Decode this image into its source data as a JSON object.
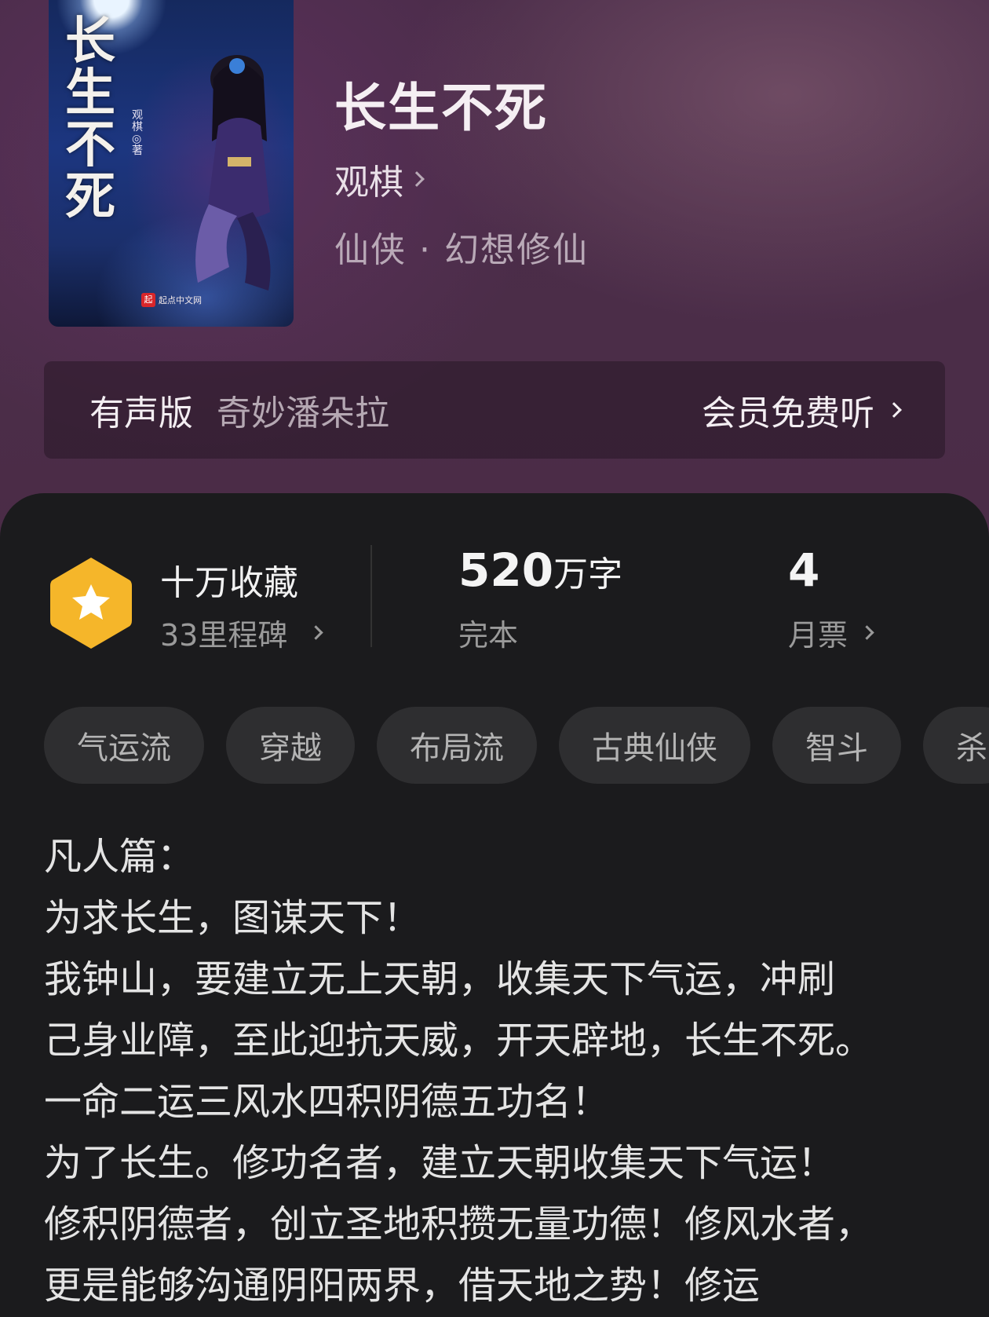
{
  "book": {
    "cover": {
      "title": "长生不死",
      "author_line": "观棋◎著",
      "publisher": "起点中文网",
      "publisher_mark": "起"
    },
    "title": "长生不死",
    "author": "观棋",
    "genre": "仙侠 · 幻想修仙"
  },
  "audio": {
    "label": "有声版",
    "narrator": "奇妙潘朵拉",
    "action": "会员免费听"
  },
  "stats": {
    "collection": "十万收藏",
    "milestone": "33里程碑",
    "word_count": "520",
    "word_unit": "万字",
    "status": "完本",
    "monthly_votes": "4",
    "monthly_label": "月票"
  },
  "tags": [
    "气运流",
    "穿越",
    "布局流",
    "古典仙侠",
    "智斗",
    "杀"
  ],
  "description": [
    "凡人篇：",
    "为求长生，图谋天下！",
    "我钟山，要建立无上天朝，收集天下气运，冲刷",
    "己身业障，至此迎抗天威，开天辟地，长生不死。",
    "一命二运三风水四积阴德五功名！",
    "为了长生。修功名者，建立天朝收集天下气运！",
    "修积阴德者，创立圣地积攒无量功德！修风水者，",
    "更是能够沟通阴阳两界，借天地之势！修运"
  ],
  "colors": {
    "header_bg": "#4a2c49",
    "sheet_bg": "#1b1b1d",
    "badge_gold": "#f5b62a",
    "tag_bg": "#2e2e30"
  },
  "icons": {
    "badge": "star-hexagon-icon",
    "chevron": "chevron-right-icon"
  }
}
